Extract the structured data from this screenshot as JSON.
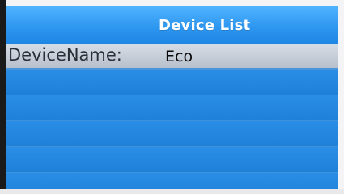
{
  "header": {
    "title": "Device List"
  },
  "device_list": {
    "items": [
      {
        "label": "DeviceName:",
        "value": "Eco",
        "selected": true
      },
      {
        "label": "",
        "value": ""
      },
      {
        "label": "",
        "value": ""
      },
      {
        "label": "",
        "value": ""
      },
      {
        "label": "",
        "value": ""
      },
      {
        "label": "",
        "value": ""
      }
    ]
  },
  "colors": {
    "background": "#1f7fd6",
    "title_bar": "#2e97f0",
    "selected_row": "#c6cdd8",
    "title_text": "#ffffff"
  }
}
